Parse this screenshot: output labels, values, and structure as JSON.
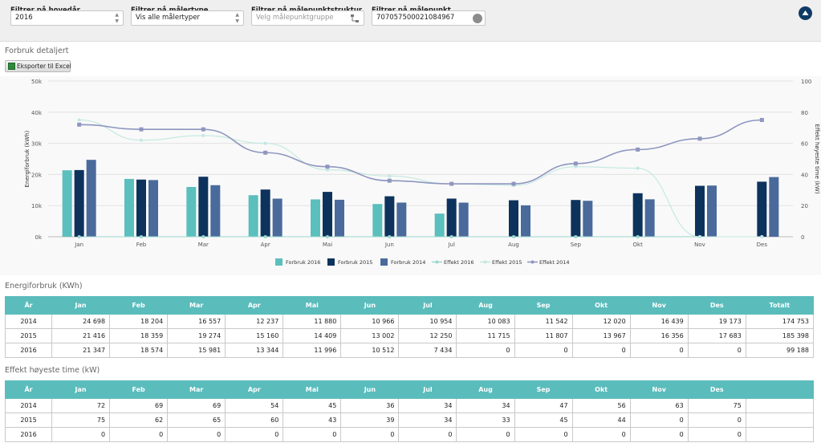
{
  "filters": {
    "main_year": {
      "label": "Filtrer på hovedår",
      "value": "2016"
    },
    "meter_type": {
      "label": "Filtrer på målertype",
      "value": "Vis alle målertyper"
    },
    "meter_structure": {
      "label": "Filtrer på målepunktstruktur",
      "placeholder": "Velg målepunktgruppe"
    },
    "meter_point": {
      "label": "Filtrer på målepunkt",
      "value": "707057500021084967"
    }
  },
  "section_title": "Forbruk detaljert",
  "export_label": "Eksporter til Excel",
  "chart_data": {
    "type": "bar",
    "categories": [
      "Jan",
      "Feb",
      "Mar",
      "Apr",
      "Mai",
      "Jun",
      "Jul",
      "Aug",
      "Sep",
      "Okt",
      "Nov",
      "Des"
    ],
    "ylabel": "Energiforbruk (kWh)",
    "y2label": "Effekt høyeste time (kW)",
    "ylim": [
      0,
      50000
    ],
    "y2lim": [
      0,
      100
    ],
    "yticks": [
      "0k",
      "10k",
      "20k",
      "30k",
      "40k",
      "50k"
    ],
    "y2ticks": [
      "0",
      "20",
      "40",
      "60",
      "80",
      "100"
    ],
    "legend_position": "bottom",
    "bar_series": [
      {
        "name": "Forbruk 2016",
        "color": "#5bbfbd",
        "values": [
          21347,
          18574,
          15981,
          13344,
          11996,
          10512,
          7434,
          0,
          0,
          0,
          0,
          0
        ]
      },
      {
        "name": "Forbruk 2015",
        "color": "#0d335d",
        "values": [
          21416,
          18359,
          19274,
          15160,
          14409,
          13002,
          12250,
          11715,
          11807,
          13967,
          16356,
          17683
        ]
      },
      {
        "name": "Forbruk 2014",
        "color": "#4a6a9c",
        "values": [
          24698,
          18204,
          16557,
          12237,
          11880,
          10966,
          10954,
          10083,
          11542,
          12020,
          16439,
          19173
        ]
      }
    ],
    "line_series": [
      {
        "name": "Effekt 2016",
        "color": "#9ad8cf",
        "values": [
          0,
          0,
          0,
          0,
          0,
          0,
          0,
          0,
          0,
          0,
          0,
          0
        ]
      },
      {
        "name": "Effekt 2015",
        "color": "#c2e8e0",
        "values": [
          75,
          62,
          65,
          60,
          43,
          39,
          34,
          33,
          45,
          44,
          0,
          0
        ]
      },
      {
        "name": "Effekt 2014",
        "color": "#8e96bf",
        "values": [
          72,
          69,
          69,
          54,
          45,
          36,
          34,
          34,
          47,
          56,
          63,
          75
        ]
      }
    ]
  },
  "energy_table": {
    "title": "Energiforbruk (KWh)",
    "headers": [
      "År",
      "Jan",
      "Feb",
      "Mar",
      "Apr",
      "Mai",
      "Jun",
      "Jul",
      "Aug",
      "Sep",
      "Okt",
      "Nov",
      "Des",
      "Totalt"
    ],
    "rows": [
      [
        "2014",
        "24 698",
        "18 204",
        "16 557",
        "12 237",
        "11 880",
        "10 966",
        "10 954",
        "10 083",
        "11 542",
        "12 020",
        "16 439",
        "19 173",
        "174 753"
      ],
      [
        "2015",
        "21 416",
        "18 359",
        "19 274",
        "15 160",
        "14 409",
        "13 002",
        "12 250",
        "11 715",
        "11 807",
        "13 967",
        "16 356",
        "17 683",
        "185 398"
      ],
      [
        "2016",
        "21 347",
        "18 574",
        "15 981",
        "13 344",
        "11 996",
        "10 512",
        "7 434",
        "0",
        "0",
        "0",
        "0",
        "0",
        "99 188"
      ]
    ]
  },
  "effect_table": {
    "title": "Effekt høyeste time (kW)",
    "headers": [
      "År",
      "Jan",
      "Feb",
      "Mar",
      "Apr",
      "Mai",
      "Jun",
      "Jul",
      "Aug",
      "Sep",
      "Okt",
      "Nov",
      "Des",
      ""
    ],
    "rows": [
      [
        "2014",
        "72",
        "69",
        "69",
        "54",
        "45",
        "36",
        "34",
        "34",
        "47",
        "56",
        "63",
        "75",
        ""
      ],
      [
        "2015",
        "75",
        "62",
        "65",
        "60",
        "43",
        "39",
        "34",
        "33",
        "45",
        "44",
        "0",
        "0",
        ""
      ],
      [
        "2016",
        "0",
        "0",
        "0",
        "0",
        "0",
        "0",
        "0",
        "0",
        "0",
        "0",
        "0",
        "0",
        ""
      ]
    ]
  }
}
